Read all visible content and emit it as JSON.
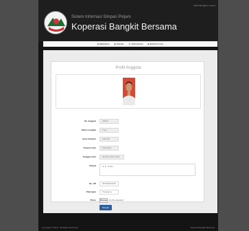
{
  "header": {
    "user_link": "Hak Pelanggan | Logout",
    "subtitle": "Sistem Informasi Simpan Pinjam",
    "title": "Koperasi Bangkit Bersama"
  },
  "nav": [
    {
      "icon": "home-icon",
      "glyph": "■",
      "label": "BERANDA"
    },
    {
      "icon": "user-icon",
      "glyph": "♟",
      "label": "PROFIL"
    },
    {
      "icon": "exchange-icon",
      "glyph": "⇄",
      "label": "TRANSAKSI"
    },
    {
      "icon": "book-icon",
      "glyph": "■",
      "label": "RIWAYAT KAS"
    }
  ],
  "profile": {
    "title": "Profil Anggota",
    "fields": {
      "no_anggota": {
        "label": "No Anggota",
        "value": "A0010"
      },
      "nama_lengkap": {
        "label": "Nama Lengkap",
        "value": "Tuyo"
      },
      "jenis_kelamin": {
        "label": "Jenis Kelamin",
        "value": "Laki-laki"
      },
      "tempat_lahir": {
        "label": "Tempat Lahir",
        "value": "Sukoharjo"
      },
      "tanggal_lahir": {
        "label": "Tanggal Lahir",
        "value": "20 Desember 2012"
      },
      "alamat": {
        "label": "Alamat",
        "value": "Jl. E. Tuhan"
      },
      "no_hp": {
        "label": "No. HP",
        "value": "081500000000"
      },
      "pekerjaan": {
        "label": "Pekerjaan",
        "value": "Pedagang"
      },
      "photo": {
        "label": "Photo",
        "button": "Browse...",
        "status": "No file selected."
      }
    },
    "submit_label": "Simpan"
  },
  "footer": {
    "left": "Copyright © 2018 - All Rights Reserved",
    "right": "Koperasi Bangkit Bersama"
  }
}
